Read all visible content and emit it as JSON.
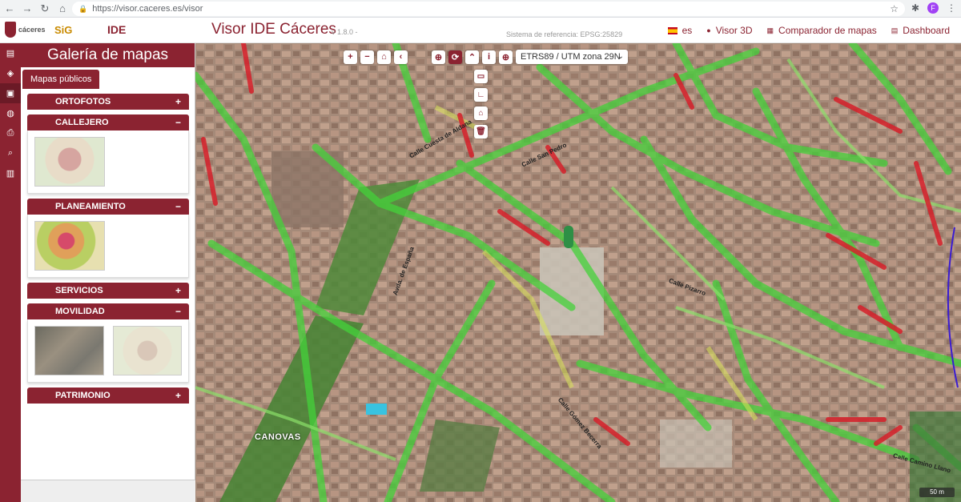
{
  "browser": {
    "url": "https://visor.caceres.es/visor",
    "profile_initial": "F"
  },
  "header": {
    "logos": {
      "caceres": "cáceres",
      "sig": "SiG",
      "sig_sub": "Cáceres",
      "ide": "IDE",
      "ide_sub": "Cáceres"
    },
    "title": "Visor IDE Cáceres",
    "version": "v 1.8.0 -",
    "ref_system": "Sistema de referencia: EPSG:25829",
    "language": "es",
    "links": [
      {
        "label": "Visor 3D",
        "icon": "cube-icon"
      },
      {
        "label": "Comparador de mapas",
        "icon": "grid-icon"
      },
      {
        "label": "Dashboard",
        "icon": "dashboard-icon"
      }
    ]
  },
  "rail": {
    "items": [
      {
        "name": "map-icon",
        "glyph": "▤"
      },
      {
        "name": "layers-icon",
        "glyph": "◈"
      },
      {
        "name": "gallery-icon",
        "glyph": "▣"
      },
      {
        "name": "globe-icon",
        "glyph": "◍"
      },
      {
        "name": "print-icon",
        "glyph": "⎙"
      },
      {
        "name": "search-icon",
        "glyph": "⌕"
      },
      {
        "name": "book-icon",
        "glyph": "▥"
      }
    ]
  },
  "gallery": {
    "title": "Galería de mapas",
    "tab": "Mapas públicos",
    "sections": [
      {
        "label": "ORTOFOTOS",
        "expanded": false
      },
      {
        "label": "CALLEJERO",
        "expanded": true
      },
      {
        "label": "PLANEAMIENTO",
        "expanded": true
      },
      {
        "label": "SERVICIOS",
        "expanded": false
      },
      {
        "label": "MOVILIDAD",
        "expanded": true
      },
      {
        "label": "PATRIMONIO",
        "expanded": false
      }
    ],
    "expand_symbol": "+",
    "collapse_symbol": "−"
  },
  "map": {
    "toolbar": {
      "zoom_in": "+",
      "zoom_out": "−",
      "home": "⌂",
      "back": "‹",
      "zoom_box": "⊕",
      "refresh": "⟳",
      "up": "⌃",
      "info": "i",
      "globe": "⊕"
    },
    "srs_select": "ETRS89 / UTM zona 29N",
    "draw_tools": [
      "▭",
      "∟",
      "⌂",
      "🗑"
    ],
    "scale": "50 m",
    "district_label": "CANOVAS",
    "street_labels": [
      "Calle Cuesta de Aldana",
      "Calle San Pedro",
      "Calle Pizarro",
      "Avda. de España",
      "Calle Camino Llano",
      "Calle Gómez Becerra"
    ]
  },
  "colors": {
    "brand": "#8b2331",
    "heat_green": "#44d23a",
    "heat_red": "#d6202a",
    "heat_yellow": "#d8e35a"
  }
}
